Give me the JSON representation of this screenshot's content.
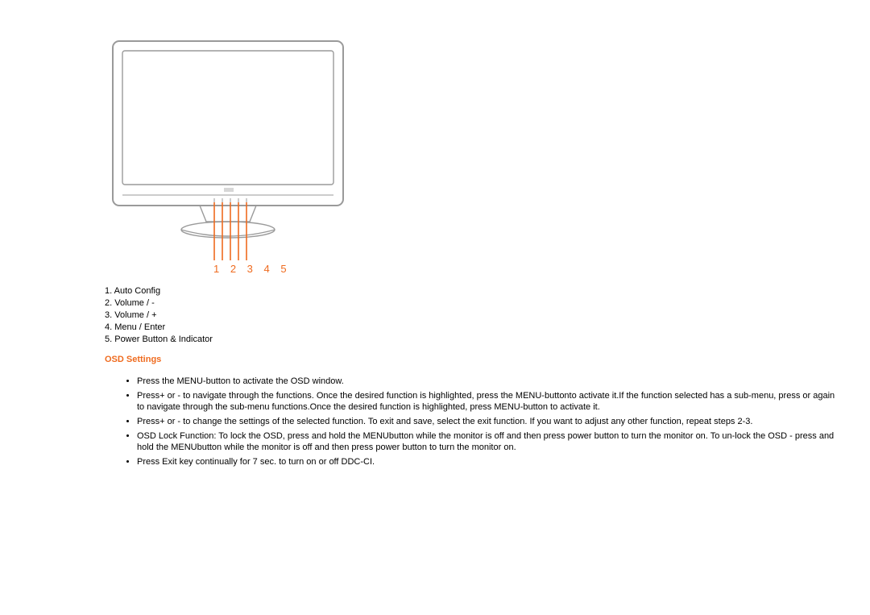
{
  "figure": {
    "numbers": "1 2 3 4 5"
  },
  "legend": {
    "items": [
      "1. Auto Config",
      "2. Volume / -",
      "3. Volume / +",
      "4. Menu / Enter",
      "5. Power Button & Indicator"
    ]
  },
  "section": {
    "title": "OSD Settings"
  },
  "osd": {
    "bullets": [
      "Press the MENU-button to activate the OSD window.",
      "Press+ or - to navigate through the functions. Once the desired function is highlighted, press the MENU-buttonto activate it.If the function selected has a sub-menu, press or again to navigate through the sub-menu functions.Once the desired function is highlighted, press MENU-button to activate it.",
      "Press+ or - to change the settings of the selected function. To exit and save, select the exit function. If you want to adjust any other function, repeat steps 2-3.",
      "OSD Lock Function: To lock the OSD, press and hold the MENUbutton while the monitor is off and then press power button to turn the monitor on. To un-lock the OSD - press and hold the MENUbutton while the monitor is off and then press power button to turn the monitor on.",
      "Press Exit key continually for 7 sec. to turn on or off DDC-CI."
    ]
  }
}
